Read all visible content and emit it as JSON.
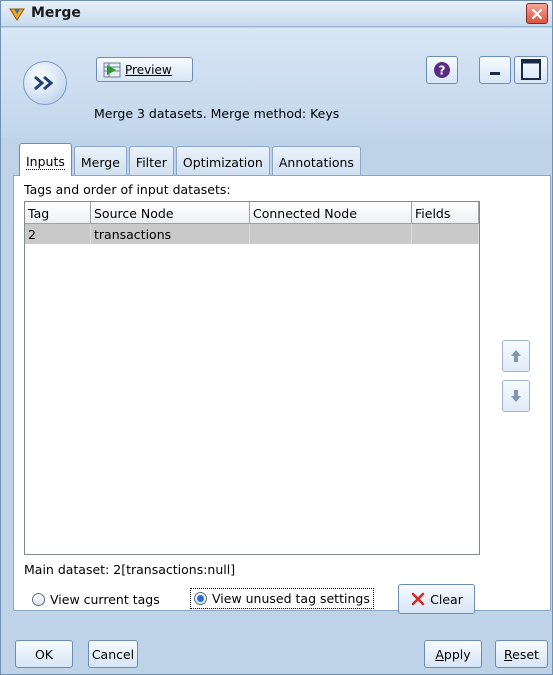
{
  "window": {
    "title": "Merge"
  },
  "header": {
    "preview_label": "Preview",
    "summary": "Merge 3 datasets. Merge method: Keys"
  },
  "tabs": [
    {
      "label": "Inputs",
      "active": true
    },
    {
      "label": "Merge",
      "active": false
    },
    {
      "label": "Filter",
      "active": false
    },
    {
      "label": "Optimization",
      "active": false
    },
    {
      "label": "Annotations",
      "active": false
    }
  ],
  "inputs": {
    "heading": "Tags and order of input datasets:",
    "columns": [
      "Tag",
      "Source Node",
      "Connected Node",
      "Fields"
    ],
    "rows": [
      {
        "tag": "2",
        "source": "transactions",
        "connected": "",
        "fields": ""
      }
    ],
    "main_dataset": "Main dataset: 2[transactions:null]",
    "view_current_tags": "View current tags",
    "view_unused_tag_settings": "View unused tag settings",
    "selected_view": "View unused tag settings",
    "clear_label": "Clear"
  },
  "buttons": {
    "ok": "OK",
    "cancel": "Cancel",
    "apply": "Apply",
    "reset": "Reset"
  },
  "colors": {
    "window_bg": "#bfd3e8",
    "selected_row": "#c9c9c9",
    "clear_x": "#d62b1f"
  }
}
